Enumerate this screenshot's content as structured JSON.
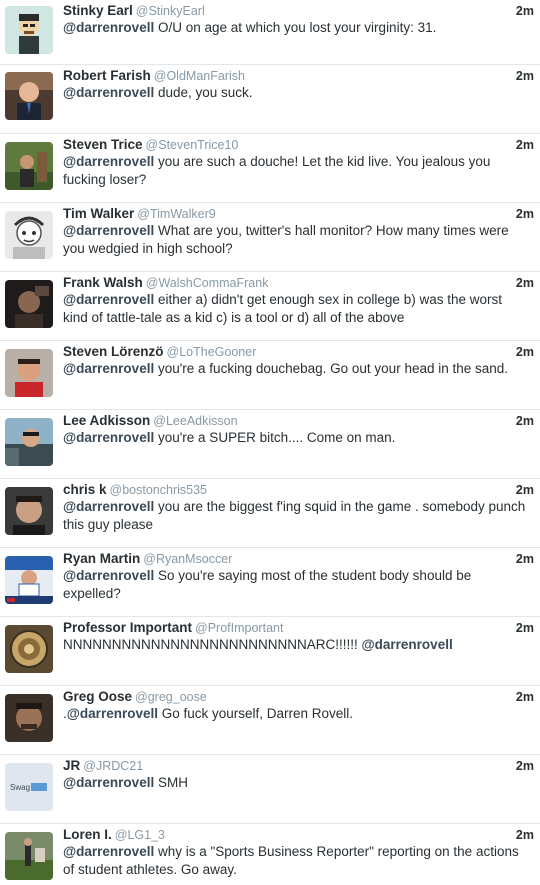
{
  "tweets": [
    {
      "name": "Stinky Earl",
      "handle": "@StinkyEarl",
      "time": "2m",
      "pre": "",
      "mention": "@darrenrovell",
      "post": " O/U on age at which you lost your virginity: 31.",
      "avatar": "cartoon"
    },
    {
      "name": "Robert Farish",
      "handle": "@OldManFarish",
      "time": "2m",
      "pre": "",
      "mention": "@darrenrovell",
      "post": " dude, you suck.",
      "avatar": "suit"
    },
    {
      "name": "Steven Trice",
      "handle": "@StevenTrice10",
      "time": "2m",
      "pre": "",
      "mention": "@darrenrovell",
      "post": " you are such a douche! Let the kid live. You jealous you fucking loser?",
      "avatar": "outdoor"
    },
    {
      "name": "Tim Walker",
      "handle": "@TimWalker9",
      "time": "2m",
      "pre": "",
      "mention": "@darrenrovell",
      "post": " What are you, twitter's hall monitor? How many times were you wedgied in high school?",
      "avatar": "sketch"
    },
    {
      "name": "Frank Walsh",
      "handle": "@WalshCommaFrank",
      "time": "2m",
      "pre": "",
      "mention": "@darrenrovell",
      "post": " either a) didn't get enough sex in college b) was the worst kind of tattle-tale as a kid c) is a tool or d) all of the above",
      "avatar": "dark"
    },
    {
      "name": "Steven Lörenzö",
      "handle": "@LoTheGooner",
      "time": "2m",
      "pre": "",
      "mention": "@darrenrovell",
      "post": " you're a fucking douchebag. Go out your head in the sand.",
      "avatar": "red"
    },
    {
      "name": "Lee Adkisson",
      "handle": "@LeeAdkisson",
      "time": "2m",
      "pre": "",
      "mention": "@darrenrovell",
      "post": " you're a SUPER bitch.... Come on man.",
      "avatar": "car"
    },
    {
      "name": "chris k",
      "handle": "@bostonchris535",
      "time": "2m",
      "pre": "",
      "mention": "@darrenrovell",
      "post": " you are the biggest f'ing squid in the game . somebody punch this guy please",
      "avatar": "face"
    },
    {
      "name": "Ryan Martin",
      "handle": "@RyanMsoccer",
      "time": "2m",
      "pre": "",
      "mention": "@darrenrovell",
      "post": " So you're saying most of the student body should be expelled?",
      "avatar": "soccer"
    },
    {
      "name": "Professor Important",
      "handle": "@ProfImportant",
      "time": "2m",
      "pre": "NNNNNNNNNNNNNNNNNNNNNNNNNARC!!!!!! ",
      "mention": "@darrenrovell",
      "post": "",
      "avatar": "seal"
    },
    {
      "name": "Greg Oose",
      "handle": "@greg_oose",
      "time": "2m",
      "pre": ".",
      "mention": "@darrenrovell",
      "post": " Go fuck yourself, Darren Rovell.",
      "avatar": "portrait"
    },
    {
      "name": "JR",
      "handle": "@JRDC21",
      "time": "2m",
      "pre": "",
      "mention": "@darrenrovell",
      "post": " SMH",
      "avatar": "swag",
      "avatar_text": "Swag"
    },
    {
      "name": "Loren I.",
      "handle": "@LG1_3",
      "time": "2m",
      "pre": "",
      "mention": "@darrenrovell",
      "post": " why is a \"Sports Business Reporter\" reporting on the actions of student athletes. Go away.",
      "avatar": "field"
    }
  ]
}
